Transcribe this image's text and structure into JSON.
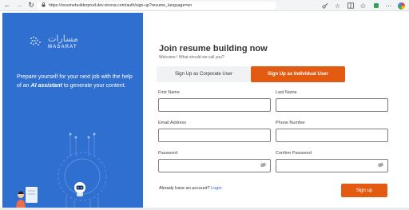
{
  "browser": {
    "url": "https://resumebuilderprod.dev.vinova.com/auth/sign-up?resume_language=en",
    "back_glyph": "←",
    "forward_glyph": "→",
    "reload_glyph": "↻",
    "lock_glyph": "🔒"
  },
  "brand": {
    "logo_arabic": "مسارات",
    "logo_latin": "MASARAT",
    "tagline_part1": "Prepare yourself for your next job with the help of an ",
    "tagline_highlight": "AI assistant",
    "tagline_part2": " to generate your content."
  },
  "form": {
    "title": "Join resume building now",
    "subtitle": "Welcome ! What should we call you?",
    "tabs": [
      {
        "label": "Sign Up as Corporate User",
        "active": false
      },
      {
        "label": "Sign Up as Individual User",
        "active": true
      }
    ],
    "fields": {
      "first_name": {
        "label": "First Name",
        "value": ""
      },
      "last_name": {
        "label": "Last Name",
        "value": ""
      },
      "email": {
        "label": "Email Address",
        "value": ""
      },
      "phone": {
        "label": "Phone Number",
        "value": ""
      },
      "password": {
        "label": "Password",
        "value": ""
      },
      "confirm_password": {
        "label": "Confirm Password",
        "value": ""
      }
    },
    "login_prompt": "Already have an account? ",
    "login_link": "Login",
    "submit_label": "Sign up"
  },
  "colors": {
    "brand_blue": "#2f6fd0",
    "accent_orange": "#e35b12"
  }
}
